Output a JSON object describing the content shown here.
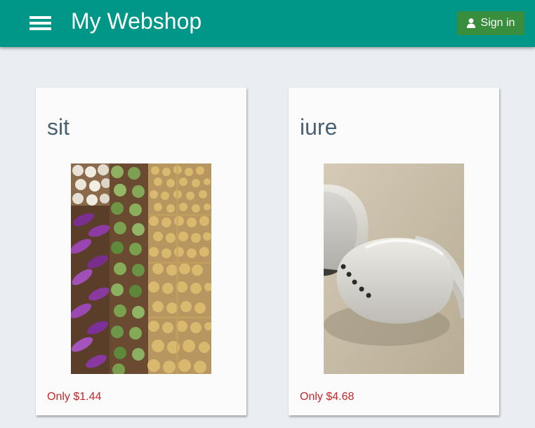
{
  "header": {
    "title": "My Webshop",
    "signin_label": "Sign in",
    "background_color": "#009688",
    "signin_color": "#388e3c"
  },
  "products": [
    {
      "title": "sit",
      "price": "Only $1.44",
      "image": "market-vegetables-photo"
    },
    {
      "title": "iure",
      "price": "Only $4.68",
      "image": "earbuds-photo"
    }
  ],
  "colors": {
    "page_background": "#eaeef2",
    "price_text": "#c62828",
    "card_title_text": "#4a6272"
  }
}
